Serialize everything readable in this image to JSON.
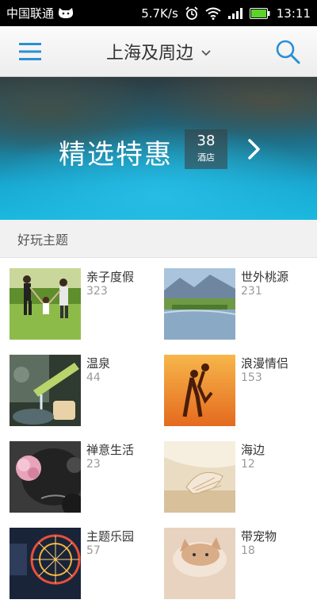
{
  "status_bar": {
    "carrier": "中国联通",
    "speed": "5.7K/s",
    "time": "13:11"
  },
  "nav": {
    "city": "上海及周边",
    "menu_icon": "hamburger-menu-icon",
    "search_icon": "search-icon",
    "dropdown_icon": "chevron-down-icon"
  },
  "banner": {
    "title": "精选特惠",
    "hotel_count": "38",
    "hotel_unit": "酒店",
    "arrow_icon": "chevron-right-icon"
  },
  "section": {
    "title": "好玩主题"
  },
  "themes": [
    {
      "name": "亲子度假",
      "count": "323",
      "image": "family-on-lawn-photo"
    },
    {
      "name": "世外桃源",
      "count": "231",
      "image": "mountain-lake-photo"
    },
    {
      "name": "温泉",
      "count": "44",
      "image": "bamboo-spring-photo"
    },
    {
      "name": "浪漫情侣",
      "count": "153",
      "image": "couple-sunset-photo"
    },
    {
      "name": "禅意生活",
      "count": "23",
      "image": "flower-stones-photo"
    },
    {
      "name": "海边",
      "count": "12",
      "image": "seashell-beach-photo"
    },
    {
      "name": "主题乐园",
      "count": "57",
      "image": "ferris-wheel-photo"
    },
    {
      "name": "带宠物",
      "count": "18",
      "image": "kitten-photo"
    }
  ],
  "colors": {
    "accent": "#2a8fd6",
    "banner_blue": "#1ab8de",
    "status_battery": "#5bd32a"
  }
}
